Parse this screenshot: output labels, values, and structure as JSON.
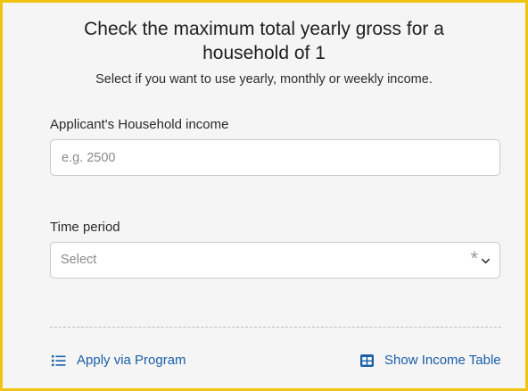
{
  "header": {
    "title": "Check the maximum total yearly gross for a household of 1",
    "subtitle": "Select if you want to use yearly, monthly or weekly income."
  },
  "income_field": {
    "label": "Applicant's Household income",
    "placeholder": "e.g. 2500",
    "value": ""
  },
  "period_field": {
    "label": "Time period",
    "placeholder": "Select",
    "required_marker": "*"
  },
  "footer": {
    "apply_label": "Apply via Program",
    "table_label": "Show Income Table"
  },
  "colors": {
    "frame_border": "#f1c40f",
    "link": "#1a5fa8",
    "background": "#f5f5f5"
  },
  "icons": {
    "apply": "list-icon",
    "table": "table-icon",
    "select": "chevron-down-icon"
  }
}
